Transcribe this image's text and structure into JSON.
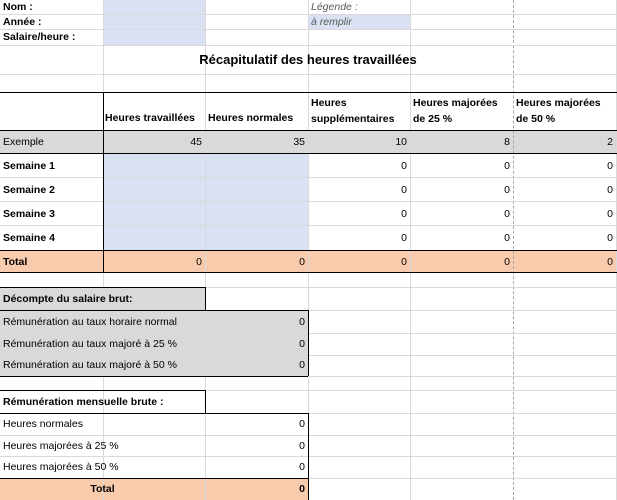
{
  "top": {
    "name_label": "Nom :",
    "year_label": "Année :",
    "rate_label": "Salaire/heure :",
    "legend_label": "Légende :",
    "legend_fill": "à remplir"
  },
  "title": "Récapitulatif des heures travaillées",
  "table": {
    "headers": [
      "Heures travaillées",
      "Heures normales",
      "Heures supplémentaires",
      "Heures majorées de 25 %",
      "Heures majorées de 50 %"
    ],
    "example": {
      "label": "Exemple",
      "values": [
        "45",
        "35",
        "10",
        "8",
        "2"
      ]
    },
    "weeks": [
      {
        "label": "Semaine 1",
        "values": [
          "0",
          "0",
          "0"
        ]
      },
      {
        "label": "Semaine 2",
        "values": [
          "0",
          "0",
          "0"
        ]
      },
      {
        "label": "Semaine 3",
        "values": [
          "0",
          "0",
          "0"
        ]
      },
      {
        "label": "Semaine 4",
        "values": [
          "0",
          "0",
          "0"
        ]
      }
    ],
    "total": {
      "label": "Total",
      "values": [
        "0",
        "0",
        "0",
        "0",
        "0"
      ]
    }
  },
  "brut": {
    "title": "Décompte du salaire brut:",
    "rows": [
      {
        "label": "Rémunération au taux horaire normal",
        "value": "0"
      },
      {
        "label": "Rémunération au taux majoré à 25 %",
        "value": "0"
      },
      {
        "label": "Rémunération au taux majoré à 50 %",
        "value": "0"
      }
    ]
  },
  "mensuel": {
    "title": "Rémunération mensuelle brute :",
    "rows": [
      {
        "label": "Heures normales",
        "value": "0"
      },
      {
        "label": "Heures majorées à 25 %",
        "value": "0"
      },
      {
        "label": "Heures majorées à 50 %",
        "value": "0"
      }
    ],
    "total": {
      "label": "Total",
      "value": "0"
    }
  },
  "colors": {
    "input_fill": "#d9e1f2",
    "example_fill": "#d9d9d9",
    "total_fill": "#f8cbad"
  }
}
